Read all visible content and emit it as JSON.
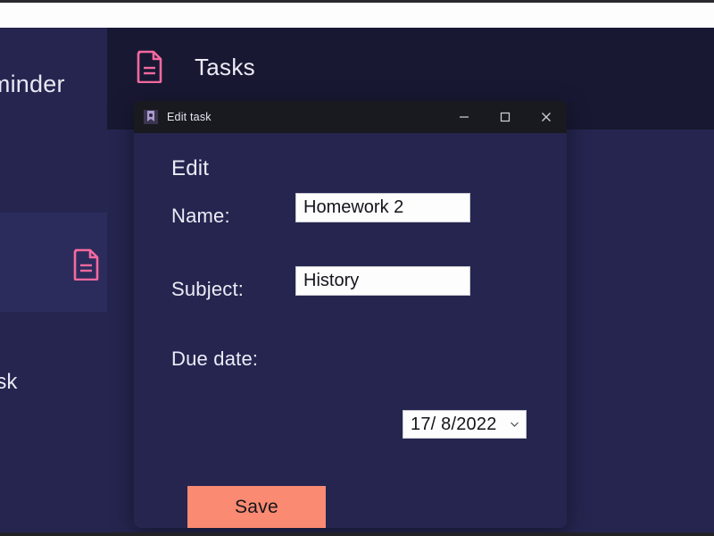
{
  "app": {
    "sidebar": {
      "brand_label": "Reminder",
      "doc_icon": "document-icon",
      "cut_item_label": "Task"
    },
    "header": {
      "icon": "document-icon",
      "title": "Tasks"
    },
    "colors": {
      "app_background": "#252550",
      "header_background": "#181833",
      "accent_pink": "#f4699f",
      "accent_salmon": "#fa8a71",
      "titlebar_background": "#191920",
      "input_background": "#fdfdfd",
      "text_light": "#eceCf6"
    }
  },
  "dialog": {
    "titlebar": {
      "icon": "app-bookmark-icon",
      "title": "Edit task",
      "minimize_label": "—",
      "maximize_label": "☐",
      "close_label": "✕"
    },
    "heading": "Edit",
    "fields": {
      "name": {
        "label": "Name:",
        "value": "Homework 2",
        "placeholder": ""
      },
      "subject": {
        "label": "Subject:",
        "value": "History",
        "placeholder": ""
      },
      "due_date": {
        "label": "Due date:",
        "value": "17/ 8/2022",
        "day": "17",
        "month": "8",
        "year": "2022",
        "caret_icon": "chevron-down-icon"
      }
    },
    "save_button_label": "Save"
  }
}
